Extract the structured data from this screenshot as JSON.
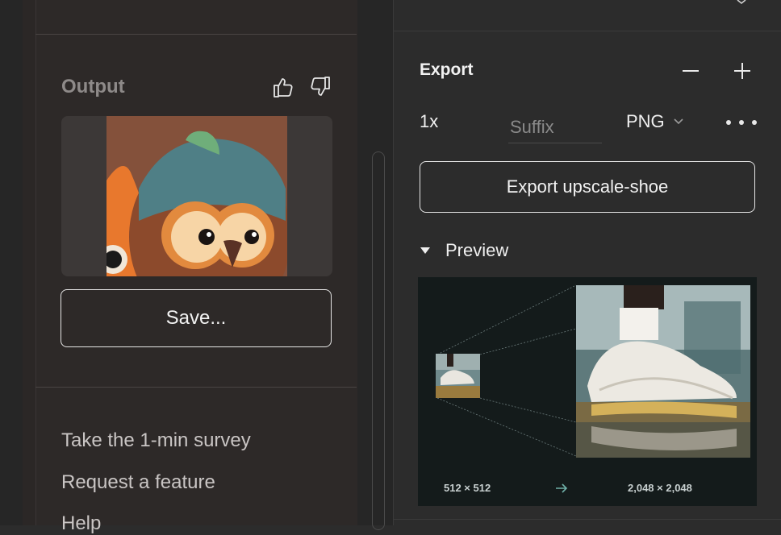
{
  "plugin": {
    "output_title": "Output",
    "thumbs_up_icon": "thumbs-up-icon",
    "thumbs_down_icon": "thumbs-down-icon",
    "save_label": "Save...",
    "links": [
      "Take the 1-min survey",
      "Request a feature",
      "Help"
    ]
  },
  "export": {
    "title": "Export",
    "remove_icon": "minus-icon",
    "add_icon": "plus-icon",
    "scale": "1x",
    "suffix_placeholder": "Suffix",
    "format": "PNG",
    "more_icon": "more-horizontal-icon",
    "export_button_label": "Export upscale-shoe",
    "preview_label": "Preview",
    "preview": {
      "source_size": "512 × 512",
      "target_size": "2,048 × 2,048",
      "arrow_icon": "arrow-right-icon"
    }
  },
  "colors": {
    "panel_bg": "#2c2c2c",
    "plugin_bg": "#2d2928",
    "preview_bg": "#141b1b",
    "text": "#f2f2f2",
    "muted": "#8e8a89"
  }
}
